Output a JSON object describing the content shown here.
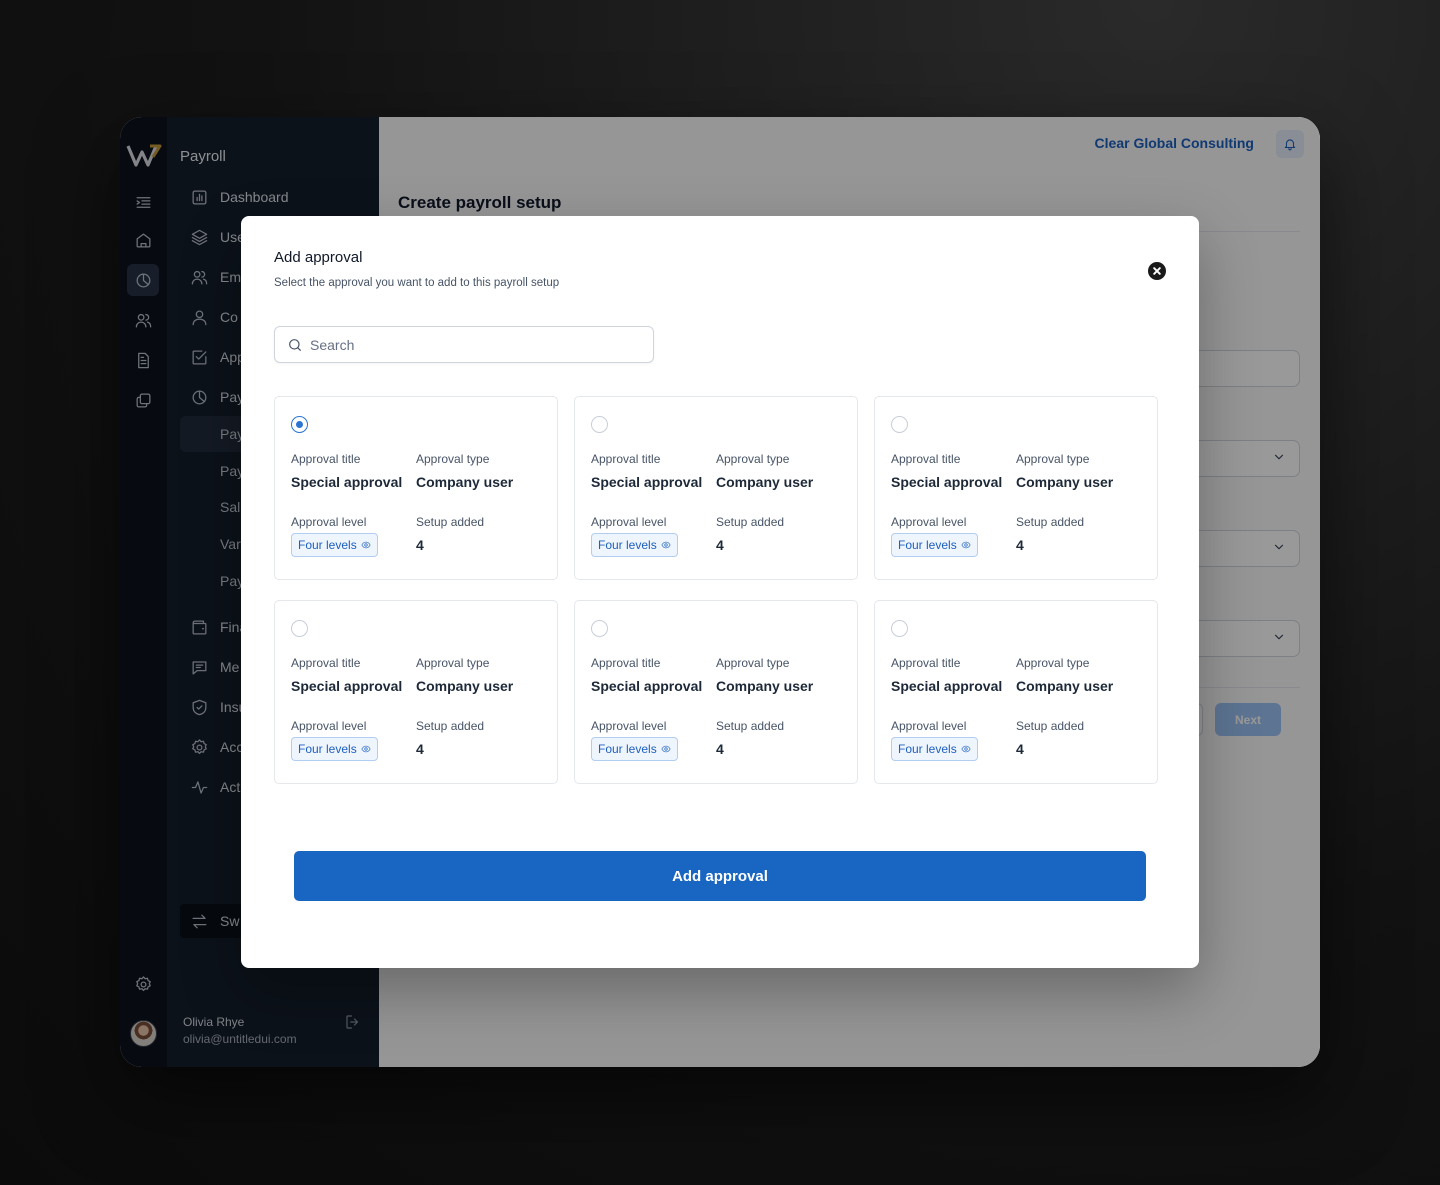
{
  "sidebar": {
    "title": "Payroll",
    "items": [
      {
        "label": "Dashboard"
      },
      {
        "label": "Use"
      },
      {
        "label": "Em"
      },
      {
        "label": "Co"
      },
      {
        "label": "App"
      },
      {
        "label": "Pay"
      },
      {
        "label": "Pay"
      },
      {
        "label": "Pay"
      },
      {
        "label": "Sal"
      },
      {
        "label": "Var"
      },
      {
        "label": "Pay"
      },
      {
        "label": "Fina"
      },
      {
        "label": "Me"
      },
      {
        "label": "Insu"
      },
      {
        "label": "Acc"
      },
      {
        "label": "Act"
      }
    ],
    "switch_label": "Sw",
    "user": {
      "name": "Olivia Rhye",
      "email": "olivia@untitledui.com"
    }
  },
  "header": {
    "company": "Clear Global Consulting"
  },
  "page": {
    "title": "Create payroll setup",
    "next_label": "Next"
  },
  "modal": {
    "title": "Add approval",
    "subtitle": "Select the approval you want to add to this payroll setup",
    "search_placeholder": "Search",
    "labels": {
      "title": "Approval title",
      "type": "Approval type",
      "level": "Approval level",
      "setup": "Setup added"
    },
    "cards": [
      {
        "selected": true,
        "title": "Special approval",
        "type": "Company user",
        "level": "Four levels",
        "setup": "4"
      },
      {
        "selected": false,
        "title": "Special approval",
        "type": "Company user",
        "level": "Four levels",
        "setup": "4"
      },
      {
        "selected": false,
        "title": "Special approval",
        "type": "Company user",
        "level": "Four levels",
        "setup": "4"
      },
      {
        "selected": false,
        "title": "Special approval",
        "type": "Company user",
        "level": "Four levels",
        "setup": "4"
      },
      {
        "selected": false,
        "title": "Special approval",
        "type": "Company user",
        "level": "Four levels",
        "setup": "4"
      },
      {
        "selected": false,
        "title": "Special approval",
        "type": "Company user",
        "level": "Four levels",
        "setup": "4"
      }
    ],
    "submit_label": "Add approval"
  },
  "colors": {
    "accent": "#1865c2",
    "sidebar": "#151e2c",
    "rail": "#0c121d"
  }
}
